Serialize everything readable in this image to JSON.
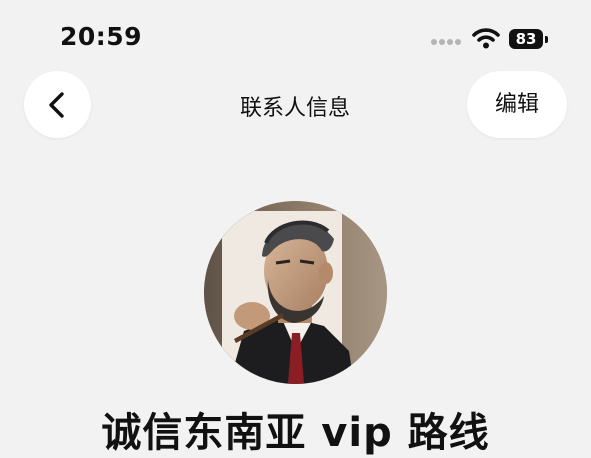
{
  "status_bar": {
    "time": "20:59",
    "battery_level": "83"
  },
  "nav": {
    "back_icon": "chevron-left-icon",
    "title": "联系人信息",
    "edit_label": "编辑"
  },
  "contact": {
    "name": "诚信东南亚 vip 路线"
  }
}
